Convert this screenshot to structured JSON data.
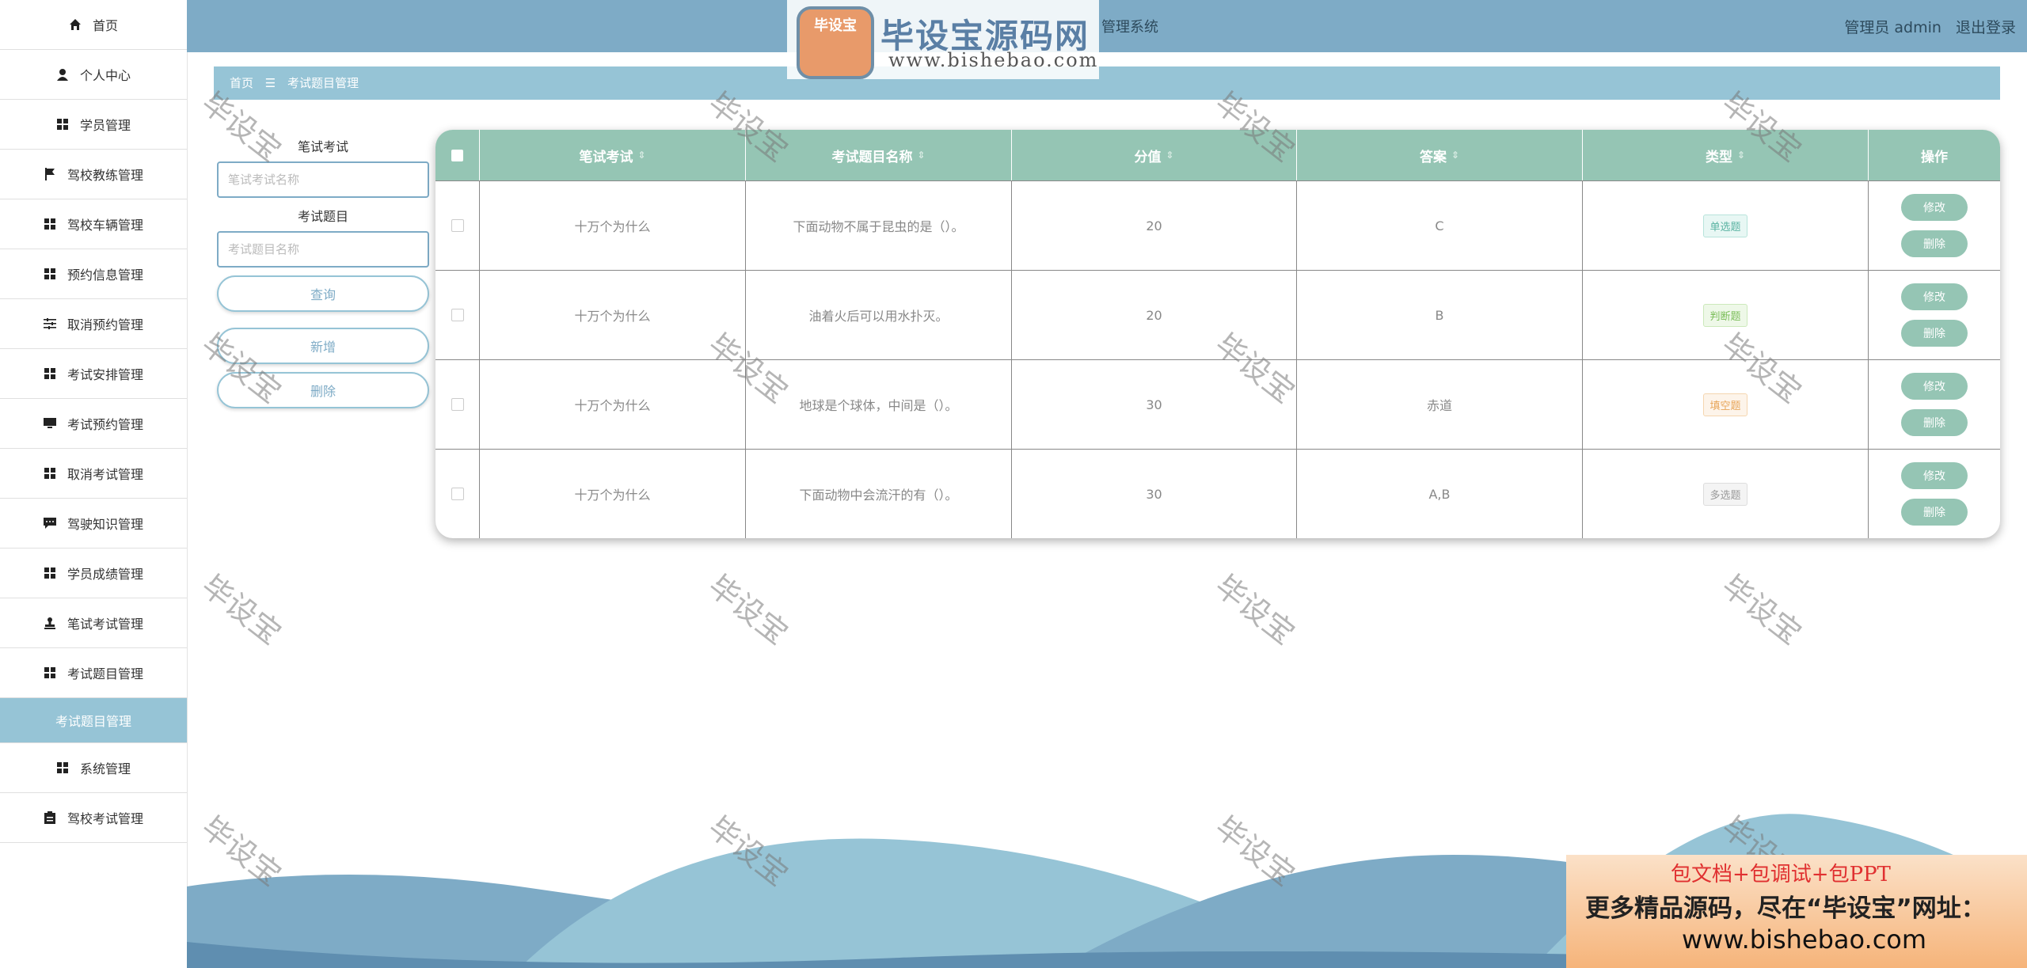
{
  "header": {
    "title": "管理系统",
    "user_label": "管理员 admin",
    "logout": "退出登录"
  },
  "logo": {
    "seal": "毕设宝",
    "name": "毕设宝源码网",
    "url": "www.bishebao.com"
  },
  "sidebar": {
    "items": [
      {
        "label": "首页",
        "icon": "home-icon"
      },
      {
        "label": "个人中心",
        "icon": "user-icon"
      },
      {
        "label": "学员管理",
        "icon": "grid-icon"
      },
      {
        "label": "驾校教练管理",
        "icon": "flag-icon"
      },
      {
        "label": "驾校车辆管理",
        "icon": "grid-icon"
      },
      {
        "label": "预约信息管理",
        "icon": "grid-icon"
      },
      {
        "label": "取消预约管理",
        "icon": "sliders-icon"
      },
      {
        "label": "考试安排管理",
        "icon": "grid-icon"
      },
      {
        "label": "考试预约管理",
        "icon": "monitor-icon"
      },
      {
        "label": "取消考试管理",
        "icon": "grid-icon"
      },
      {
        "label": "驾驶知识管理",
        "icon": "chat-icon"
      },
      {
        "label": "学员成绩管理",
        "icon": "grid-icon"
      },
      {
        "label": "笔试考试管理",
        "icon": "stamp-icon"
      },
      {
        "label": "考试题目管理",
        "icon": "grid-icon"
      }
    ],
    "active_item": "考试题目管理",
    "items_after": [
      {
        "label": "系统管理",
        "icon": "grid-icon"
      },
      {
        "label": "驾校考试管理",
        "icon": "clipboard-icon"
      }
    ]
  },
  "breadcrumb": {
    "home": "首页",
    "separator": "☰",
    "current": "考试题目管理"
  },
  "search": {
    "exam_label": "笔试考试",
    "exam_placeholder": "笔试考试名称",
    "question_label": "考试题目",
    "question_placeholder": "考试题目名称",
    "query_button": "查询",
    "add_button": "新增",
    "delete_button": "删除"
  },
  "table": {
    "columns": [
      "笔试考试",
      "考试题目名称",
      "分值",
      "答案",
      "类型",
      "操作"
    ],
    "sort_icon": "⇕",
    "edit_label": "修改",
    "delete_label": "删除",
    "rows": [
      {
        "exam": "十万个为什么",
        "question": "下面动物不属于昆虫的是（）。",
        "score": "20",
        "answer": "C",
        "type": "单选题"
      },
      {
        "exam": "十万个为什么",
        "question": "油着火后可以用水扑灭。",
        "score": "20",
        "answer": "B",
        "type": "判断题"
      },
      {
        "exam": "十万个为什么",
        "question": "地球是个球体，中间是（）。",
        "score": "30",
        "answer": "赤道",
        "type": "填空题"
      },
      {
        "exam": "十万个为什么",
        "question": "下面动物中会流汗的有（）。",
        "score": "30",
        "answer": "A,B",
        "type": "多选题"
      }
    ]
  },
  "watermark": "毕设宝",
  "ad": {
    "line1": "包文档+包调试+包PPT",
    "line2": "更多精品源码，尽在“毕设宝”网址：",
    "line3": "www.bishebao.com"
  },
  "colors": {
    "header": "#7eabc6",
    "breadcrumb": "#96c4d6",
    "table_head": "#95c5b4"
  }
}
